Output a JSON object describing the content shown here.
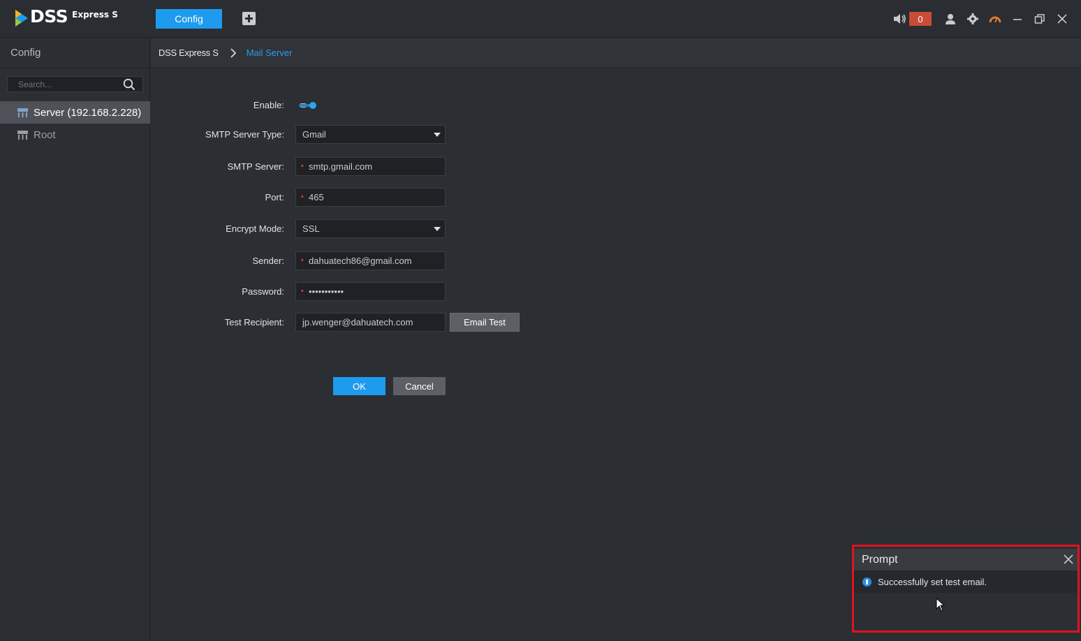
{
  "titlebar": {
    "logo_dss": "DSS",
    "logo_express": "Express S",
    "active_tab": "Config",
    "alarm_count": "0"
  },
  "sidebar": {
    "title": "Config",
    "search_placeholder": "Search...",
    "items": [
      {
        "label": "Server (192.168.2.228)",
        "selected": true
      },
      {
        "label": "Root",
        "selected": false
      }
    ]
  },
  "breadcrumb": {
    "root": "DSS Express S",
    "current": "Mail Server"
  },
  "form": {
    "enable_label": "Enable:",
    "enable_value": "on",
    "smtp_type_label": "SMTP Server Type:",
    "smtp_type_value": "Gmail",
    "smtp_server_label": "SMTP Server:",
    "smtp_server_value": "smtp.gmail.com",
    "port_label": "Port:",
    "port_value": "465",
    "encrypt_label": "Encrypt Mode:",
    "encrypt_value": "SSL",
    "sender_label": "Sender:",
    "sender_value": "dahuatech86@gmail.com",
    "password_label": "Password:",
    "password_value": "•••••••••••",
    "recipient_label": "Test Recipient:",
    "recipient_value": "jp.wenger@dahuatech.com",
    "email_test_label": "Email Test",
    "ok_label": "OK",
    "cancel_label": "Cancel"
  },
  "prompt": {
    "title": "Prompt",
    "message": "Successfully set test email."
  },
  "colors": {
    "accent": "#1e9bef",
    "alarm": "#c94b3a",
    "highlight_border": "#e2121e"
  }
}
